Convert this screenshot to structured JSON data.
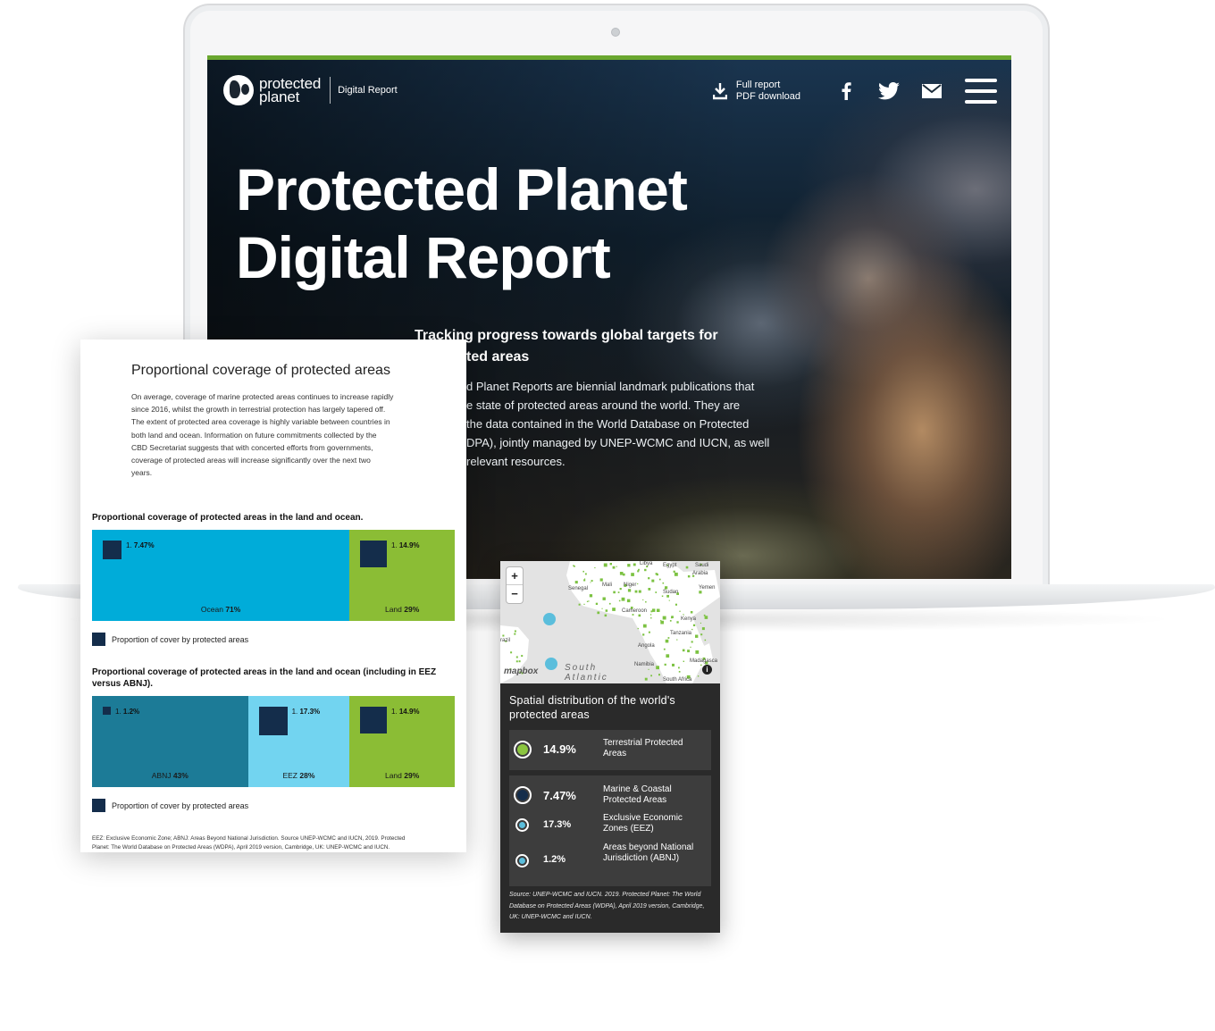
{
  "site": {
    "logo_line1": "protected",
    "logo_line2": "planet",
    "logo_subtitle": "Digital Report",
    "download_line1": "Full report",
    "download_line2": "PDF download",
    "icons": [
      "download-icon",
      "facebook-icon",
      "twitter-icon",
      "email-icon",
      "menu-icon"
    ],
    "accent_color": "#6aa72f"
  },
  "hero": {
    "title_line1": "Protected Planet",
    "title_line2": "Digital Report",
    "subtitle_line1": "Tracking progress towards global targets for",
    "subtitle_line2": "ted areas",
    "body_lines": [
      "d Planet Reports are biennial landmark publications that",
      "e state of protected areas around the world. They are",
      "the data contained in the World Database on Protected",
      "DPA), jointly managed by UNEP-WCMC and IUCN, as well",
      "relevant resources."
    ]
  },
  "document": {
    "title": "Proportional coverage of protected areas",
    "paragraph_lines": [
      "On average, coverage of marine protected areas continues to increase rapidly",
      "since 2016, whilst the growth in terrestrial protection has largely tapered off.",
      "The extent of protected area coverage is highly variable between countries in",
      "both land and ocean. Information on future commitments collected by the",
      "CBD Secretariat suggests that with concerted efforts from governments,",
      "coverage of protected areas will increase significantly over the next two",
      "years."
    ],
    "chart1_heading": "Proportional coverage of protected areas in the land and ocean.",
    "chart2_heading": "Proportional coverage of protected areas in the land and ocean (including in EEZ versus ABNJ).",
    "legend_label": "Proportion of cover by protected areas",
    "footnote_line1": "EEZ: Exclusive Economic Zone; ABNJ: Areas Beyond National Jurisdiction. Source UNEP-WCMC and IUCN, 2019. Protected",
    "footnote_line2": "Planet: The World Database on Protected Areas (WDPA), April 2019 version, Cambridge, UK: UNEP-WCMC and IUCN.",
    "colors": {
      "ocean": "#00acd9",
      "land": "#8bbd35",
      "abnj": "#1c7b97",
      "eez": "#72d4f0",
      "protected": "#142d4b"
    }
  },
  "chart_data": [
    {
      "type": "bar",
      "title": "Proportional coverage of protected areas in the land and ocean.",
      "categories": [
        "Ocean",
        "Land"
      ],
      "series": [
        {
          "name": "",
          "values": [
            71,
            29
          ]
        },
        {
          "name": "Proportion of cover by protected areas",
          "values": [
            7.47,
            14.9
          ]
        }
      ],
      "labels": {
        "share": [
          "71%",
          "29%"
        ],
        "protected": [
          "7.47%",
          "14.9%"
        ],
        "index": [
          "1.",
          "1."
        ]
      }
    },
    {
      "type": "bar",
      "title": "Proportional coverage of protected areas in the land and ocean (including in EEZ versus ABNJ).",
      "categories": [
        "ABNJ",
        "EEZ",
        "Land"
      ],
      "series": [
        {
          "name": "",
          "values": [
            43,
            28,
            29
          ]
        },
        {
          "name": "Proportion of cover by protected areas",
          "values": [
            1.2,
            17.3,
            14.9
          ]
        }
      ],
      "labels": {
        "share": [
          "43%",
          "28%",
          "29%"
        ],
        "protected": [
          "1.2%",
          "17.3%",
          "14.9%"
        ],
        "index": [
          "1.",
          "1.",
          "1."
        ]
      }
    }
  ],
  "map": {
    "zoom_in": "+",
    "zoom_out": "−",
    "attribution": "mapbox",
    "ocean_label": "South",
    "ocean_label2": "Atlantic",
    "info": "i",
    "place_labels": [
      "Libya",
      "Egypt",
      "Saudi",
      "Arabia",
      "Senegal",
      "Mali",
      "Niger",
      "Sudan",
      "Yemen",
      "Cameroon",
      "Kenya",
      "Tanzania",
      "Angola",
      "Namibia",
      "Madagasca",
      "South Africa",
      "razil"
    ],
    "title": "Spatial distribution of the world's protected areas",
    "stats": [
      {
        "value": "14.9%",
        "label": "Terrestrial Protected Areas",
        "color": "#8bc53f"
      },
      {
        "value": "7.47%",
        "label": "Marine & Coastal Protected Areas",
        "color": "#142d4b"
      },
      {
        "value": "17.3%",
        "label": "Exclusive Economic Zones (EEZ)",
        "color": "#5bbedc"
      },
      {
        "value": "1.2%",
        "label": "Areas beyond National Jurisdiction (ABNJ)",
        "color": "#1c7b97"
      }
    ],
    "source": "Source: UNEP-WCMC and IUCN. 2019. Protected Planet: The World Database on Protected Areas (WDPA), April 2019 version, Cambridge, UK: UNEP-WCMC and IUCN."
  }
}
